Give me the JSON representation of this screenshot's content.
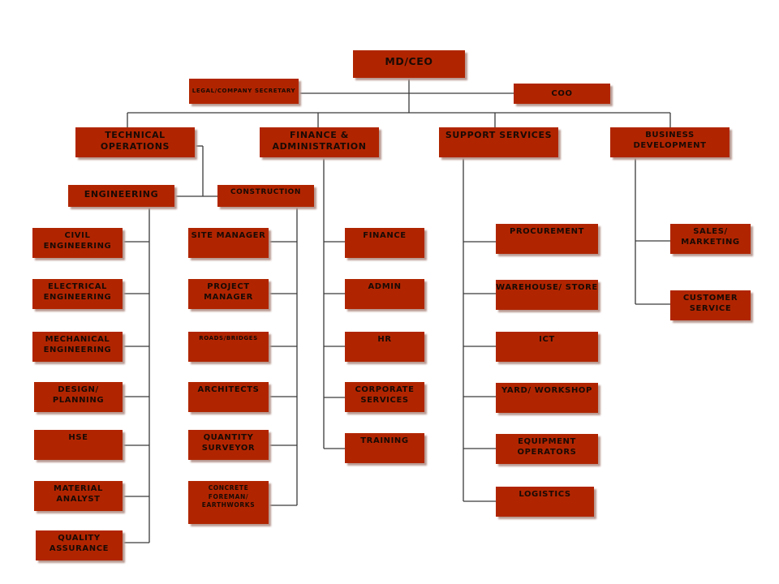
{
  "chart": {
    "title_box": "MD/CEO",
    "top": {
      "legal": "LEGAL/COMPANY SECRETARY",
      "coo": "COO"
    },
    "divisions": {
      "technical": "TECHNICAL OPERATIONS",
      "finance": "FINANCE & ADMINISTRATION",
      "support": "SUPPORT SERVICES",
      "business": "BUSINESS DEVELOPMENT"
    },
    "sub_divisions": {
      "engineering": "ENGINEERING",
      "construction": "CONSTRUCTION"
    },
    "engineering_units": [
      "CIVIL ENGINEERING",
      "ELECTRICAL ENGINEERING",
      "MECHANICAL ENGINEERING",
      "DESIGN/ PLANNING",
      "HSE",
      "MATERIAL ANALYST",
      "QUALITY ASSURANCE"
    ],
    "construction_units": [
      "SITE MANAGER",
      "PROJECT MANAGER",
      "ROADS/BRIDGES",
      "ARCHITECTS",
      "QUANTITY SURVEYOR",
      "CONCRETE FOREMAN/ EARTHWORKS"
    ],
    "finance_units": [
      "FINANCE",
      "ADMIN",
      "HR",
      "CORPORATE SERVICES",
      "TRAINING"
    ],
    "support_units": [
      "PROCUREMENT",
      "WAREHOUSE/ STORE",
      "ICT",
      "YARD/ WORKSHOP",
      "EQUIPMENT OPERATORS",
      "LOGISTICS"
    ],
    "business_units": [
      "SALES/ MARKETING",
      "CUSTOMER SERVICE"
    ]
  },
  "colors": {
    "box_fill": "#b02500",
    "text": "#1a0a05",
    "line": "#333333"
  }
}
